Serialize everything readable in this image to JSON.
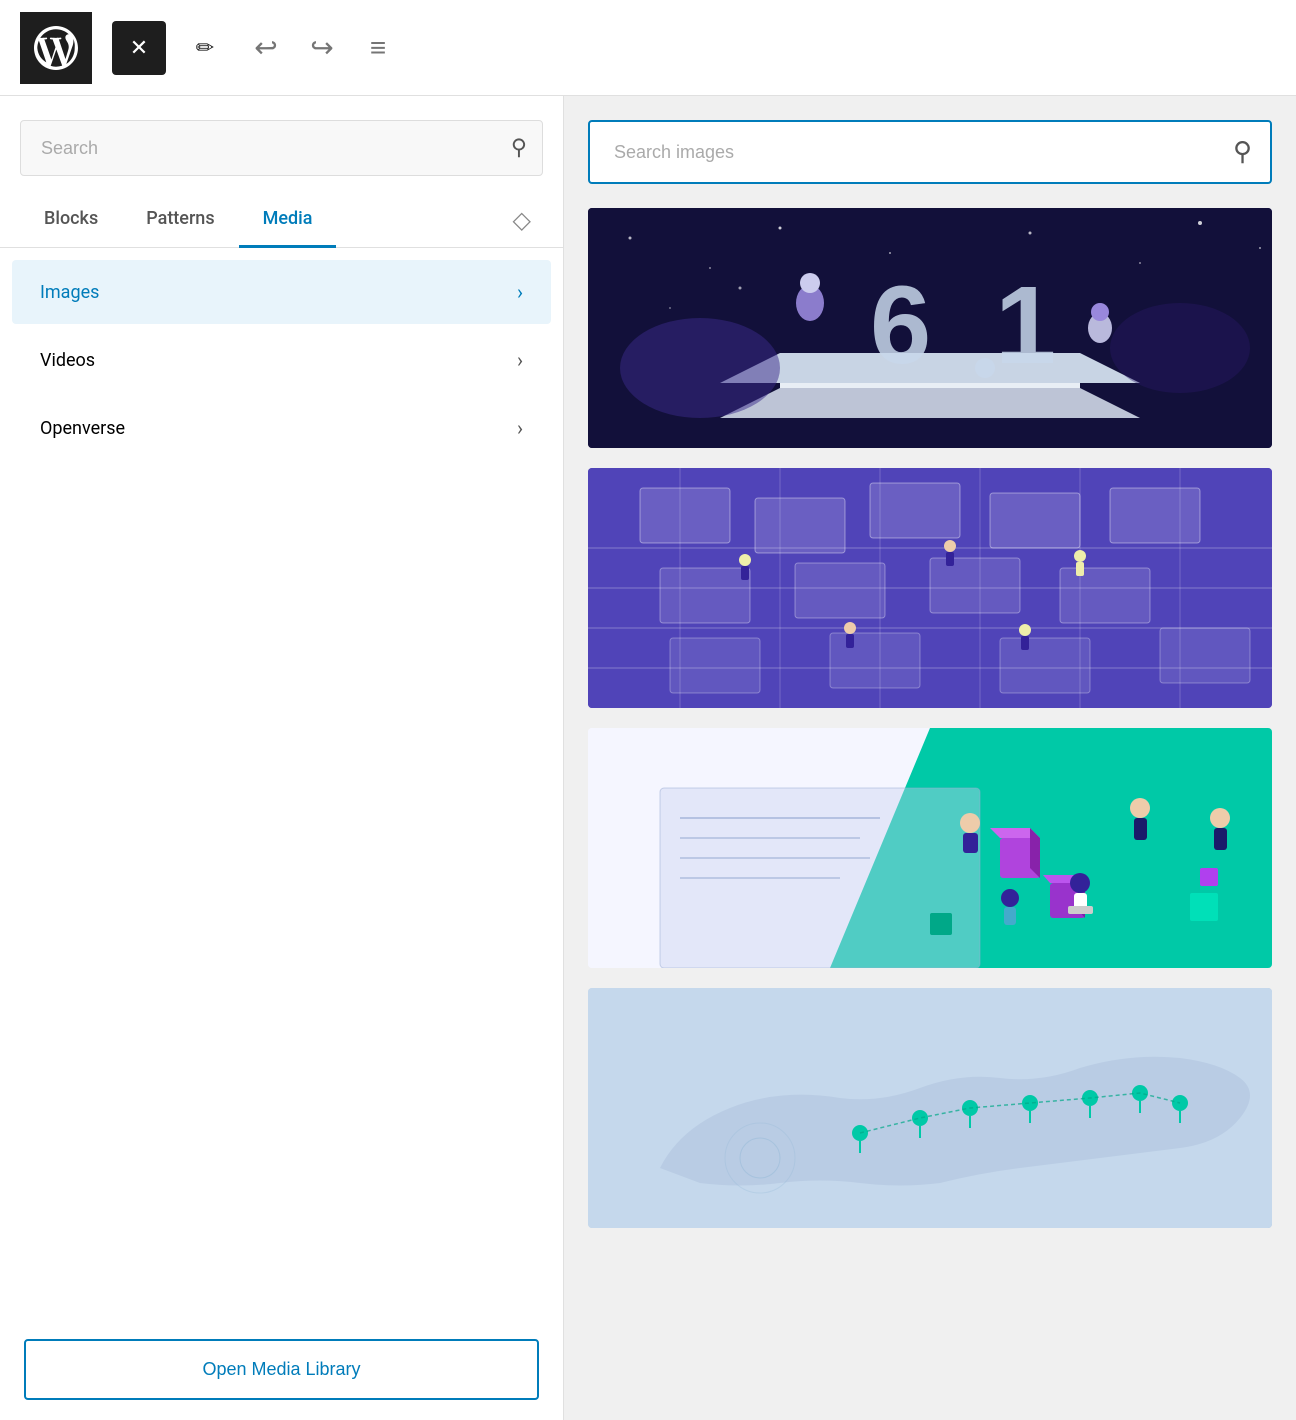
{
  "toolbar": {
    "close_label": "✕",
    "edit_icon": "✏",
    "undo_icon": "↩",
    "redo_icon": "↪",
    "menu_icon": "≡"
  },
  "left_panel": {
    "search": {
      "placeholder": "Search",
      "icon": "🔍"
    },
    "tabs": [
      {
        "label": "Blocks",
        "active": false
      },
      {
        "label": "Patterns",
        "active": false
      },
      {
        "label": "Media",
        "active": true
      }
    ],
    "tab_icon": "◇",
    "menu_items": [
      {
        "label": "Images",
        "active": true
      },
      {
        "label": "Videos",
        "active": false
      },
      {
        "label": "Openverse",
        "active": false
      }
    ],
    "open_media_label": "Open Media Library"
  },
  "right_panel": {
    "search": {
      "placeholder": "Search images",
      "icon": "🔍"
    },
    "images": [
      {
        "id": "img1",
        "alt": "WordPress 6.1 space illustration",
        "type": "space-theme"
      },
      {
        "id": "img2",
        "alt": "Purple wireframe grid illustration",
        "type": "wireframe-grid"
      },
      {
        "id": "img3",
        "alt": "Teal collaboration illustration",
        "type": "collaboration"
      },
      {
        "id": "img4",
        "alt": "Blue map illustration",
        "type": "map"
      }
    ]
  }
}
